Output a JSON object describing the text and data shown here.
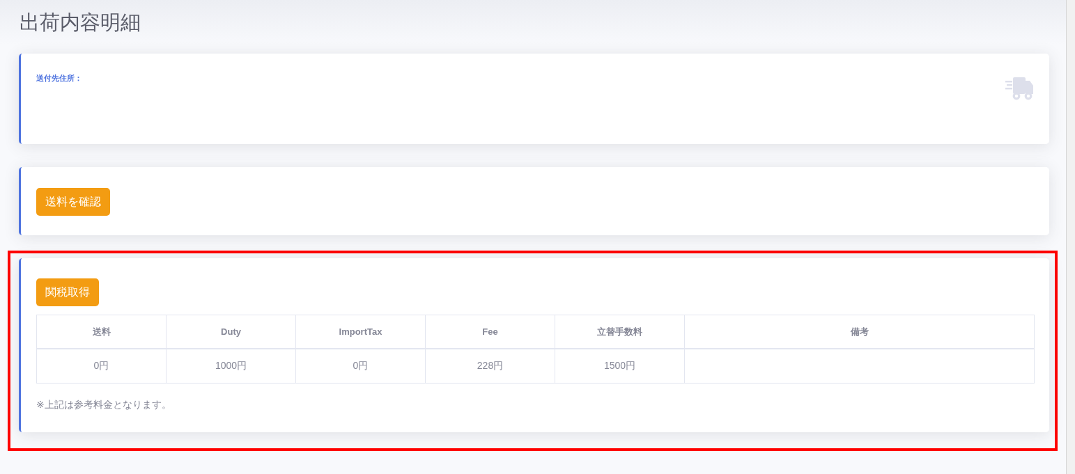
{
  "page": {
    "title": "出荷内容明細"
  },
  "cards": [
    {
      "kind": "address",
      "highlighted": false,
      "label": "送付先住所："
    },
    {
      "kind": "action",
      "highlighted": false,
      "button": "送料を確認"
    },
    {
      "kind": "customs",
      "highlighted": true,
      "button": "関税取得",
      "table": {
        "columns": [
          "送料",
          "Duty",
          "ImportTax",
          "Fee",
          "立替手数料",
          "備考"
        ],
        "rows": [
          {
            "cells": [
              "0円",
              "1000円",
              "0円",
              "228円",
              "1500円"
            ]
          }
        ]
      },
      "note": "※上記は参考料金となります。"
    }
  ]
}
